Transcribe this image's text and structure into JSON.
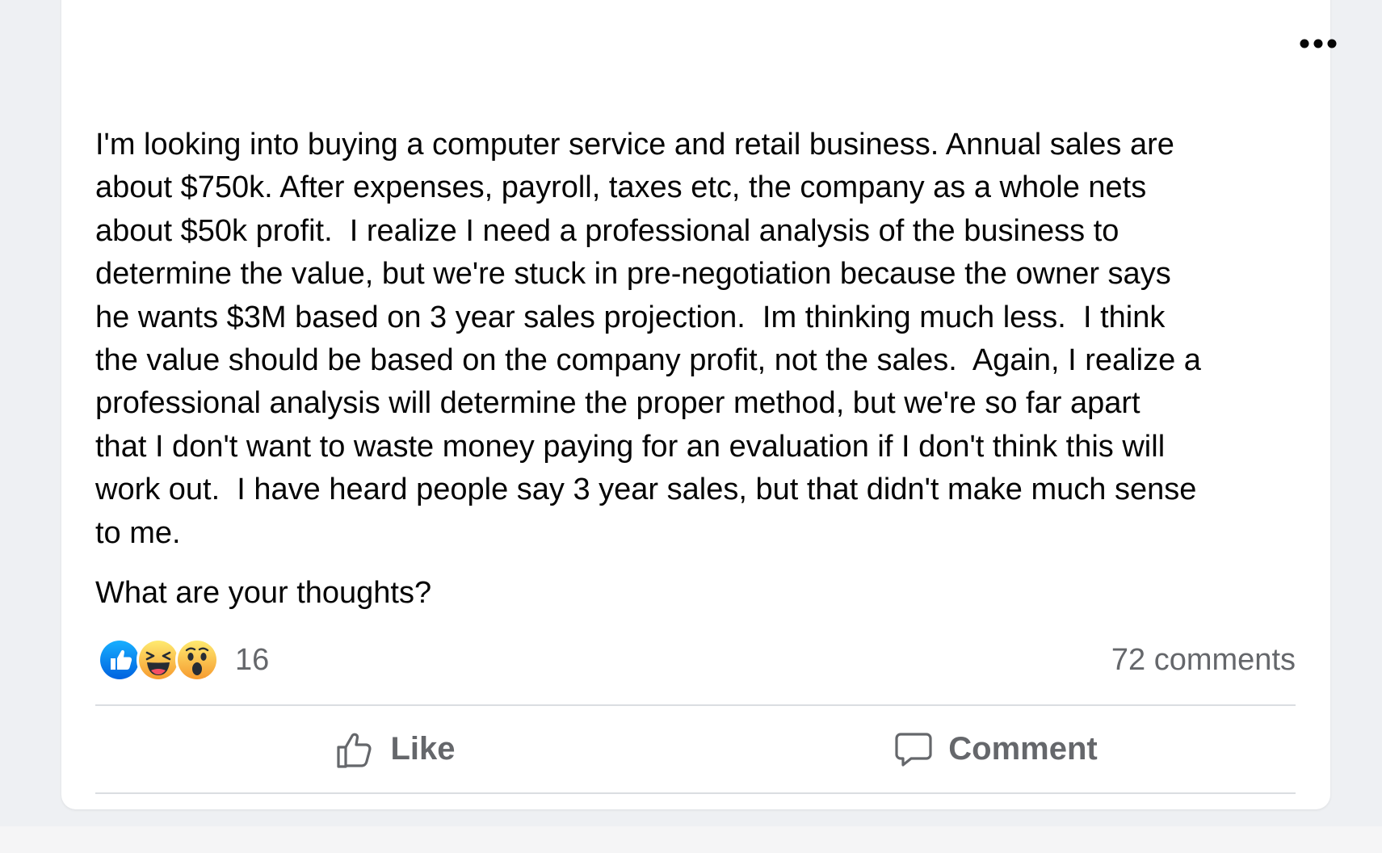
{
  "post": {
    "more_options_icon": "ellipsis-icon",
    "body": "I'm looking into buying a computer service and retail business. Annual sales are\nabout $750k. After expenses, payroll, taxes etc, the company as a whole nets\nabout $50k profit.  I realize I need a professional analysis of the business to\ndetermine the value, but we're stuck in pre-negotiation because the owner says\nhe wants $3M based on 3 year sales projection.  Im thinking much less.  I think\nthe value should be based on the company profit, not the sales.  Again, I realize a\nprofessional analysis will determine the proper method, but we're so far apart\nthat I don't want to waste money paying for an evaluation if I don't think this will\nwork out.  I have heard people say 3 year sales, but that didn't make much sense\nto me.",
    "question": "What are your thoughts?"
  },
  "reactions": {
    "icons": [
      "like-reaction-icon",
      "haha-reaction-icon",
      "wow-reaction-icon"
    ],
    "count": "16"
  },
  "comments": {
    "count_label": "72 comments"
  },
  "actions": {
    "like_label": "Like",
    "comment_label": "Comment"
  },
  "colors": {
    "like_blue": "#1877f2",
    "emoji_yellow": "#f7b125",
    "secondary_text": "#65676b",
    "primary_text": "#050505",
    "divider": "#dadde1"
  }
}
